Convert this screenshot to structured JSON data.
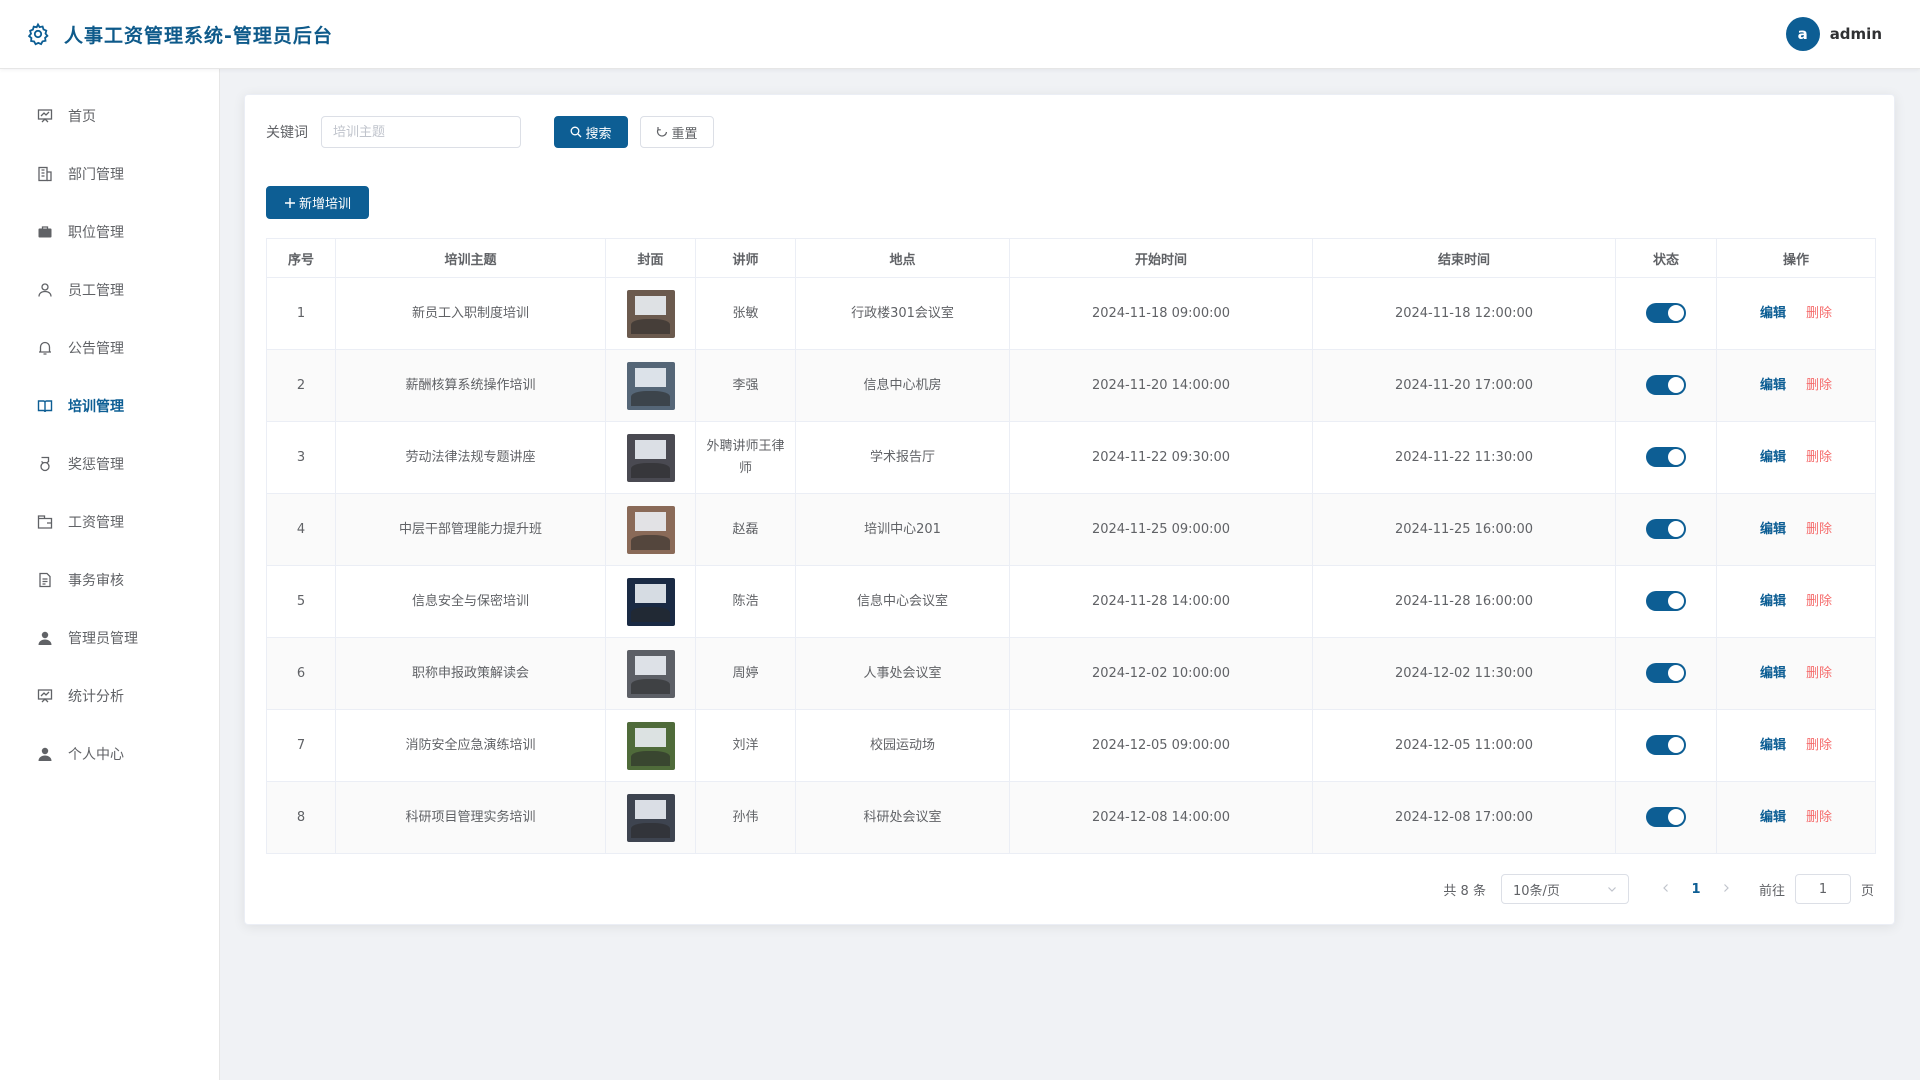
{
  "header": {
    "title": "人事工资管理系统-管理员后台",
    "avatar_letter": "a",
    "username": "admin"
  },
  "sidebar": {
    "items": [
      {
        "label": "首页",
        "icon": "dashboard-icon"
      },
      {
        "label": "部门管理",
        "icon": "building-icon"
      },
      {
        "label": "职位管理",
        "icon": "briefcase-icon"
      },
      {
        "label": "员工管理",
        "icon": "user-outline-icon"
      },
      {
        "label": "公告管理",
        "icon": "bell-icon"
      },
      {
        "label": "培训管理",
        "icon": "book-icon",
        "active": true
      },
      {
        "label": "奖惩管理",
        "icon": "medal-icon"
      },
      {
        "label": "工资管理",
        "icon": "wallet-icon"
      },
      {
        "label": "事务审核",
        "icon": "document-icon"
      },
      {
        "label": "管理员管理",
        "icon": "admin-user-icon"
      },
      {
        "label": "统计分析",
        "icon": "chart-board-icon"
      },
      {
        "label": "个人中心",
        "icon": "person-icon"
      }
    ]
  },
  "search": {
    "label": "关键词",
    "placeholder": "培训主题",
    "search_button": "搜索",
    "reset_button": "重置"
  },
  "toolbar": {
    "add_button": "新增培训"
  },
  "table": {
    "columns": [
      "序号",
      "培训主题",
      "封面",
      "讲师",
      "地点",
      "开始时间",
      "结束时间",
      "状态",
      "操作"
    ],
    "edit_label": "编辑",
    "delete_label": "删除",
    "rows": [
      {
        "index": "1",
        "topic": "新员工入职制度培训",
        "teacher": "张敏",
        "location": "行政楼301会议室",
        "start": "2024-11-18 09:00:00",
        "end": "2024-11-18 12:00:00",
        "status_on": true,
        "cover_color": "#6b5a4e"
      },
      {
        "index": "2",
        "topic": "薪酬核算系统操作培训",
        "teacher": "李强",
        "location": "信息中心机房",
        "start": "2024-11-20 14:00:00",
        "end": "2024-11-20 17:00:00",
        "status_on": true,
        "cover_color": "#556677"
      },
      {
        "index": "3",
        "topic": "劳动法律法规专题讲座",
        "teacher": "外聘讲师王律师",
        "location": "学术报告厅",
        "start": "2024-11-22 09:30:00",
        "end": "2024-11-22 11:30:00",
        "status_on": true,
        "cover_color": "#4a4a52"
      },
      {
        "index": "4",
        "topic": "中层干部管理能力提升班",
        "teacher": "赵磊",
        "location": "培训中心201",
        "start": "2024-11-25 09:00:00",
        "end": "2024-11-25 16:00:00",
        "status_on": true,
        "cover_color": "#8a6a58"
      },
      {
        "index": "5",
        "topic": "信息安全与保密培训",
        "teacher": "陈浩",
        "location": "信息中心会议室",
        "start": "2024-11-28 14:00:00",
        "end": "2024-11-28 16:00:00",
        "status_on": true,
        "cover_color": "#1a2a44"
      },
      {
        "index": "6",
        "topic": "职称申报政策解读会",
        "teacher": "周婷",
        "location": "人事处会议室",
        "start": "2024-12-02 10:00:00",
        "end": "2024-12-02 11:30:00",
        "status_on": true,
        "cover_color": "#5c5f66"
      },
      {
        "index": "7",
        "topic": "消防安全应急演练培训",
        "teacher": "刘洋",
        "location": "校园运动场",
        "start": "2024-12-05 09:00:00",
        "end": "2024-12-05 11:00:00",
        "status_on": true,
        "cover_color": "#4f6b3a"
      },
      {
        "index": "8",
        "topic": "科研项目管理实务培训",
        "teacher": "孙伟",
        "location": "科研处会议室",
        "start": "2024-12-08 14:00:00",
        "end": "2024-12-08 17:00:00",
        "status_on": true,
        "cover_color": "#3e4450"
      }
    ]
  },
  "pagination": {
    "total_text": "共 8 条",
    "page_size": "10条/页",
    "current_page": "1",
    "goto_label": "前往",
    "goto_value": "1",
    "page_unit": "页"
  },
  "colors": {
    "primary": "#0d5e94",
    "danger": "#f56c6c"
  }
}
